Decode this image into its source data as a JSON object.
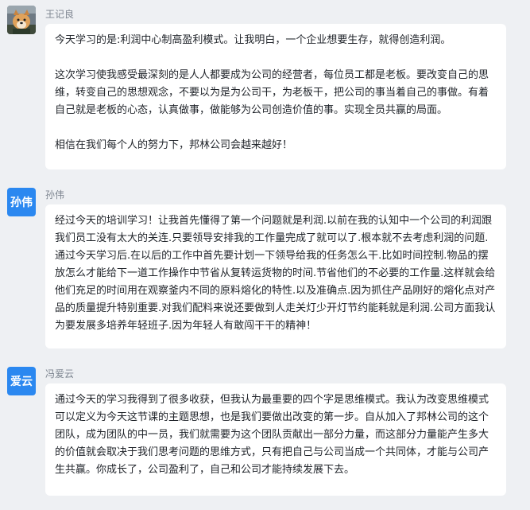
{
  "messages": [
    {
      "sender": "王记良",
      "avatar_type": "photo",
      "paragraphs": [
        "今天学习的是:利润中心制高盈利模式。让我明白，一个企业想要生存，就得创造利润。",
        "这次学习使我感受最深刻的是人人都要成为公司的经营者，每位员工都是老板。要改变自己的思维，转变自己的思想观念，不要以为是为公司干，为老板干，把公司的事当着自己的事做。有着自己就是老板的心态，认真做事，做能够为公司创造价值的事。实现全员共赢的局面。",
        "相信在我们每个人的努力下，邦林公司会越来越好！"
      ]
    },
    {
      "sender": "孙伟",
      "avatar_type": "text",
      "avatar_text": "孙伟",
      "paragraphs": [
        "经过今天的培训学习！让我首先懂得了第一个问题就是利润.以前在我的认知中一个公司的利润跟我们员工没有太大的关连.只要领导安排我的工作量完成了就可以了.根本就不去考虑利润的问题.通过今天学习后.在以后的工作中首先要计划一下领导给我的任务怎么干.比如时间控制.物品的摆放怎么才能给下一道工作操作中节省从复转运货物的时间.节省他们的不必要的工作量.这样就会给他们充足的时间用在观察釜内不同的原料熔化的特性.以及准确点.因为抓住产品刚好的熔化点对产品的质量提升特别重要.对我们配料来说还要做到人走关灯少开灯节约能耗就是利润.公司方面我认为要发展多培养年轻班子.因为年轻人有敢闯干干的精神！"
      ]
    },
    {
      "sender": "冯爱云",
      "avatar_type": "text",
      "avatar_text": "爱云",
      "paragraphs": [
        "通过今天的学习我得到了很多收获，但我认为最重要的四个字是思维模式。我认为改变思维模式可以定义为今天这节课的主题思想，也是我们要做出改变的第一步。自从加入了邦林公司的这个团队，成为团队的中一员，我们就需要为这个团队贡献出一部分力量，而这部分力量能产生多大的价值就会取决于我们思考问题的思维方式，只有把自己与公司当成一个共同体，才能与公司产生共赢。你成长了，公司盈利了，自己和公司才能持续发展下去。"
      ]
    }
  ],
  "colors": {
    "background": "#eef0f3",
    "bubble": "#ffffff",
    "avatar_blue": "#2b88f0",
    "sender_gray": "#7d8590",
    "text": "#1f2329"
  }
}
